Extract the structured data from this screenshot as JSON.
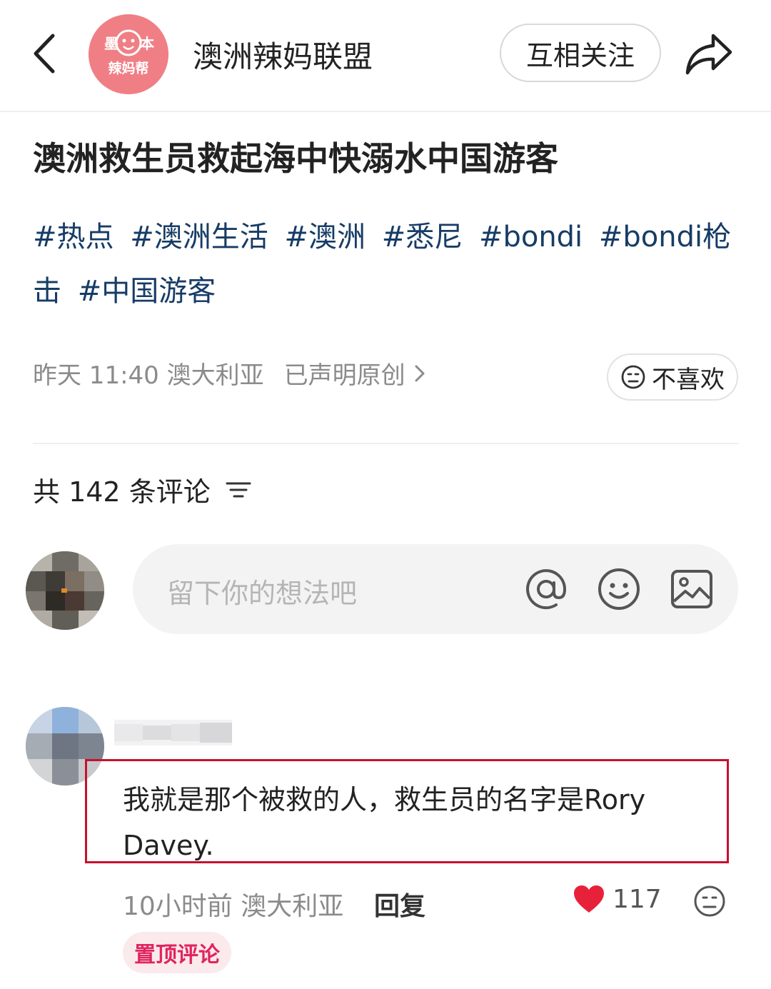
{
  "header": {
    "brand_logo_text_top": "墨本",
    "brand_logo_text_bottom": "辣妈帮",
    "author_name": "澳洲辣妈联盟",
    "follow_label": "互相关注"
  },
  "post": {
    "title": "澳洲救生员救起海中快溺水中国游客",
    "tags": [
      "#热点",
      "#澳洲生活",
      "#澳洲",
      "#悉尼",
      "#bondi",
      "#bondi枪击",
      "#中国游客"
    ],
    "time": "昨天 11:40 澳大利亚",
    "original_declared": "已声明原创",
    "dislike_label": "不喜欢"
  },
  "comments": {
    "count_label": "共 142 条评论",
    "input_placeholder": "留下你的想法吧",
    "items": [
      {
        "text": "我就是那个被救的人，救生员的名字是Rory Davey.",
        "time_location": "10小时前 澳大利亚",
        "reply_label": "回复",
        "likes": "117",
        "pinned_label": "置顶评论"
      }
    ]
  },
  "colors": {
    "brand_avatar": "#f07f85",
    "tag": "#173c66",
    "highlight_box": "#c8102e",
    "heart": "#e8213a",
    "pinned_bg": "#fbeaec",
    "pinned_text": "#e0245e"
  },
  "icons": [
    "back-icon",
    "share-icon",
    "chevron-right-icon",
    "sad-face-icon",
    "sort-icon",
    "at-icon",
    "emoji-icon",
    "image-icon",
    "heart-icon"
  ]
}
